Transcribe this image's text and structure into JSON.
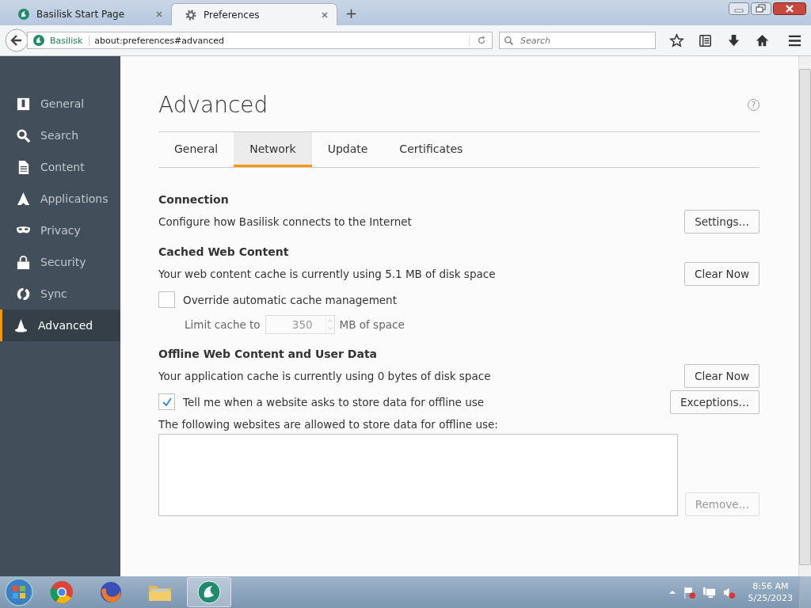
{
  "browser_tabs": [
    {
      "title": "Basilisk Start Page",
      "selected": false
    },
    {
      "title": "Preferences",
      "selected": true
    }
  ],
  "new_tab": "+",
  "nav": {
    "identity": "Basilisk",
    "url": "about:preferences#advanced",
    "search_placeholder": "Search"
  },
  "sidebar": {
    "items": [
      {
        "label": "General",
        "selected": false
      },
      {
        "label": "Search",
        "selected": false
      },
      {
        "label": "Content",
        "selected": false
      },
      {
        "label": "Applications",
        "selected": false
      },
      {
        "label": "Privacy",
        "selected": false
      },
      {
        "label": "Security",
        "selected": false
      },
      {
        "label": "Sync",
        "selected": false
      },
      {
        "label": "Advanced",
        "selected": true
      }
    ]
  },
  "page": {
    "title": "Advanced",
    "help": "?",
    "tabs": [
      {
        "label": "General",
        "selected": false
      },
      {
        "label": "Network",
        "selected": true
      },
      {
        "label": "Update",
        "selected": false
      },
      {
        "label": "Certificates",
        "selected": false
      }
    ],
    "sections": [
      {
        "heading": "Connection",
        "rows": [
          {
            "kind": "text_button",
            "text": "Configure how Basilisk connects to the Internet",
            "button": "Settings…",
            "disabled": false
          }
        ]
      },
      {
        "heading": "Cached Web Content",
        "rows": [
          {
            "kind": "text_button",
            "text": "Your web content cache is currently using 5.1 MB of disk space",
            "button": "Clear Now",
            "disabled": false
          },
          {
            "kind": "checkbox",
            "label": "Override automatic cache management",
            "checked": false
          },
          {
            "kind": "limit",
            "label": "Limit cache to",
            "value": "350",
            "unit": "MB of space",
            "disabled": true
          }
        ]
      },
      {
        "heading": "Offline Web Content and User Data",
        "rows": [
          {
            "kind": "text_button",
            "text": "Your application cache is currently using 0 bytes of disk space",
            "button": "Clear Now",
            "disabled": false
          },
          {
            "kind": "checkbox_button",
            "label": "Tell me when a website asks to store data for offline use",
            "checked": true,
            "button": "Exceptions…",
            "disabled": false
          },
          {
            "kind": "text",
            "text": "The following websites are allowed to store data for offline use:"
          },
          {
            "kind": "list",
            "button": "Remove…",
            "disabled": true
          }
        ]
      }
    ]
  },
  "taskbar": {
    "apps": [
      {
        "selected": false
      },
      {
        "selected": false
      },
      {
        "selected": false
      },
      {
        "selected": true
      }
    ],
    "time": "8:56 AM",
    "date": "5/25/2023"
  }
}
